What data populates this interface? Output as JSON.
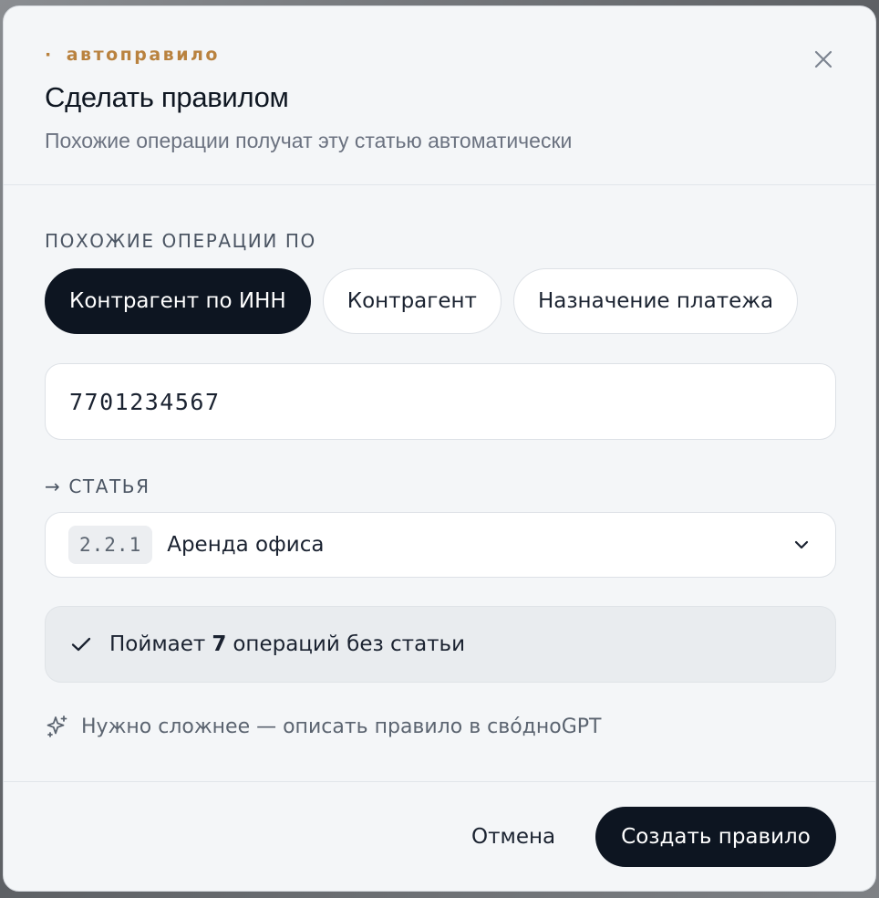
{
  "dialog": {
    "eyebrow_dot": "·",
    "eyebrow": "автоправило",
    "title": "Сделать правилом",
    "subtitle": "Похожие операции получат эту статью автоматически"
  },
  "match": {
    "label": "ПОХОЖИЕ ОПЕРАЦИИ ПО",
    "options": [
      {
        "label": "Контрагент по ИНН",
        "selected": true
      },
      {
        "label": "Контрагент",
        "selected": false
      },
      {
        "label": "Назначение платежа",
        "selected": false
      }
    ],
    "value": "7701234567"
  },
  "article": {
    "label": "→ СТАТЬЯ",
    "code": "2.2.1",
    "name": "Аренда офиса"
  },
  "notice": {
    "prefix": "Поймает",
    "count": "7",
    "suffix": "операций без статьи"
  },
  "gpt_link": "Нужно сложнее — описать правило в сво́дноGPT",
  "footer": {
    "cancel_label": "Отмена",
    "create_label": "Создать правило"
  },
  "colors": {
    "accent": "#b9823f",
    "primary": "#0d1521",
    "modal_bg": "#f4f6f8"
  }
}
